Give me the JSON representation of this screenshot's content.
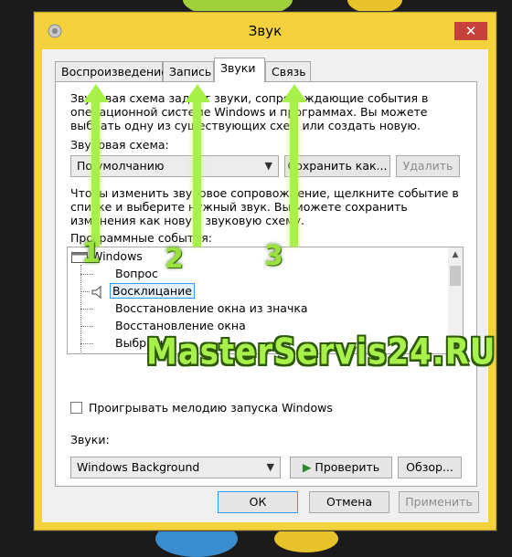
{
  "window": {
    "title": "Звук",
    "close_glyph": "✕"
  },
  "tabs": [
    {
      "label": "Воспроизведение"
    },
    {
      "label": "Запись"
    },
    {
      "label": "Звуки",
      "active": true
    },
    {
      "label": "Связь"
    }
  ],
  "sounds_tab": {
    "intro_lines": [
      "Звуковая схема задает звуки, сопровождающие события в",
      "операционной системе Windows и программах. Вы можете",
      "выбрать одну из существующих схем или создать новую."
    ],
    "scheme_label": "Звуковая схема:",
    "scheme_value": "По умолчанию",
    "save_as_label": "Сохранить как...",
    "delete_label": "Удалить",
    "instr_lines": [
      "Чтобы изменить звуковое сопровождение, щелкните событие в",
      "списке и выберите нужный звук. Вы можете сохранить",
      "изменения как новую звуковую схему."
    ],
    "events_label": "Программные события:",
    "events": [
      {
        "label": "Windows",
        "icon": "window-icon",
        "level": 0
      },
      {
        "label": "Вопрос",
        "level": 1
      },
      {
        "label": "Восклицание",
        "icon": "speaker-icon",
        "level": 1,
        "selected": true
      },
      {
        "label": "Восстановление окна из значка",
        "level": 1
      },
      {
        "label": "Восстановление окна",
        "level": 1
      },
      {
        "label": "Выбрать",
        "level": 1
      }
    ],
    "startup_checkbox_label": "Проигрывать мелодию запуска Windows",
    "startup_checked": false,
    "sounds_label": "Звуки:",
    "sound_value": "Windows Background",
    "play_label": "Проверить",
    "browse_label": "Обзор..."
  },
  "footer": {
    "ok_label": "ОК",
    "cancel_label": "Отмена",
    "apply_label": "Применить"
  },
  "annotations": {
    "markers": [
      "1",
      "2",
      "3"
    ],
    "watermark": "MasterServis24.RU",
    "accent_color": "#a8f04a"
  }
}
